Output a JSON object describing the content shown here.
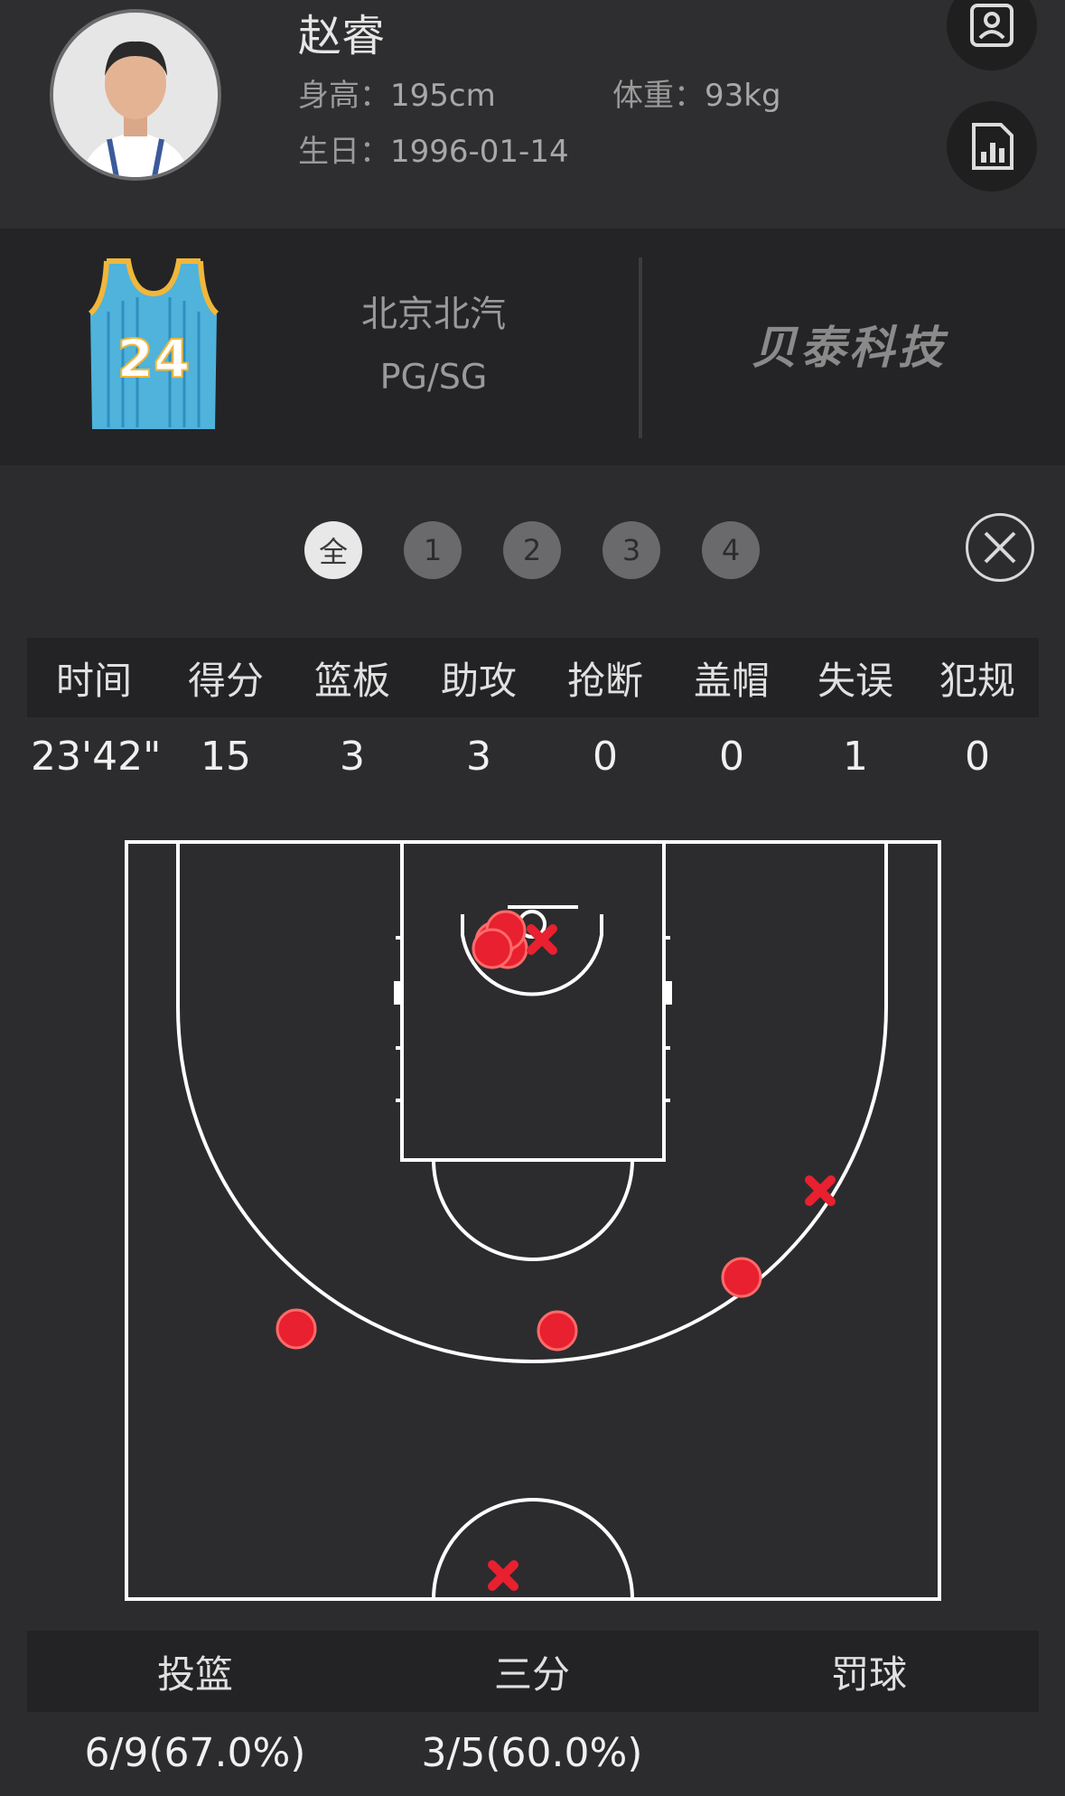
{
  "player": {
    "name": "赵睿",
    "height_label": "身高：",
    "height": "195cm",
    "weight_label": "体重：",
    "weight": "93kg",
    "birthday_label": "生日：",
    "birthday": "1996-01-14"
  },
  "team": {
    "jersey_number": "24",
    "name": "北京北汽",
    "position": "PG/SG",
    "sponsor": "贝泰科技"
  },
  "quarter_tabs": [
    "全",
    "1",
    "2",
    "3",
    "4"
  ],
  "stats": {
    "headers": [
      "时间",
      "得分",
      "篮板",
      "助攻",
      "抢断",
      "盖帽",
      "失误",
      "犯规"
    ],
    "values": [
      "23'42\"",
      "15",
      "3",
      "3",
      "0",
      "0",
      "1",
      "0"
    ]
  },
  "shot_chart": {
    "made_color": "#e8202f",
    "missed_color": "#e8202f"
  },
  "summary": {
    "headers": [
      "投篮",
      "三分",
      "罚球"
    ],
    "values": [
      "6/9(67.0%)",
      "3/5(60.0%)",
      ""
    ]
  },
  "colors": {
    "background": "#2c2c2e",
    "jersey": "#4fb3dc",
    "jersey_trim": "#f1b73a"
  }
}
